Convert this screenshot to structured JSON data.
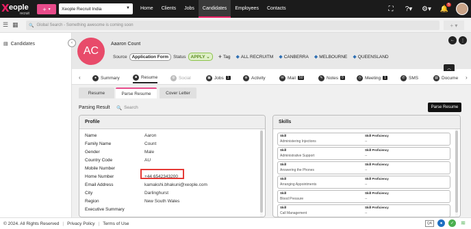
{
  "topbar": {
    "logo_main": "eople",
    "logo_sub": "recruit",
    "tenant": "Xeople Recruit India",
    "nav": [
      {
        "label": "Home"
      },
      {
        "label": "Clients"
      },
      {
        "label": "Jobs"
      },
      {
        "label": "Candidates"
      },
      {
        "label": "Employees"
      },
      {
        "label": "Contacts"
      }
    ],
    "notification_count": "5",
    "accent_color": "#e84b8a"
  },
  "searchbar": {
    "placeholder": "Global Search - Something awesome is coming soon"
  },
  "sidebar": {
    "items": [
      {
        "label": "Candidates"
      }
    ]
  },
  "candidate": {
    "initials": "AC",
    "name": "Aaaron Count",
    "source_label": "Source",
    "source_value": "Application Form",
    "status_label": "Status",
    "status_value": "APPLY",
    "add_tag_label": "Tag",
    "tags": [
      "ALL RECRUITM",
      "CANBERRA",
      "MELBOURNE",
      "QUEENSLAND"
    ]
  },
  "tabs": [
    {
      "label": "Summary",
      "count": ""
    },
    {
      "label": "Resume",
      "count": ""
    },
    {
      "label": "Social",
      "count": ""
    },
    {
      "label": "Jobs",
      "count": "1"
    },
    {
      "label": "Activity",
      "count": ""
    },
    {
      "label": "Mail",
      "count": "50"
    },
    {
      "label": "Notes",
      "count": "0"
    },
    {
      "label": "Meeting",
      "count": "1"
    },
    {
      "label": "SMS",
      "count": ""
    },
    {
      "label": "Docume",
      "count": ""
    }
  ],
  "subtabs": [
    {
      "label": "Resume"
    },
    {
      "label": "Parse Resume"
    },
    {
      "label": "Cover Letter"
    }
  ],
  "parsing": {
    "title": "Parsing Result",
    "search_placeholder": "Search",
    "parse_button": "Parse Resume"
  },
  "profile": {
    "title": "Profile",
    "rows": [
      {
        "label": "Name",
        "value": "Aaron"
      },
      {
        "label": "Family Name",
        "value": "Count"
      },
      {
        "label": "Gender",
        "value": "Male"
      },
      {
        "label": "Country Code",
        "value": "AU"
      },
      {
        "label": "Mobile Number",
        "value": ""
      },
      {
        "label": "Home Number",
        "value": "+44 6542343200"
      },
      {
        "label": "Email Address",
        "value": "kamakshi.bhakuni@xeople.com"
      },
      {
        "label": "City",
        "value": "Darlinghurst"
      },
      {
        "label": "Region",
        "value": "New South Wales"
      },
      {
        "label": "Executive Summary",
        "value": ""
      }
    ]
  },
  "skills": {
    "title": "Skills",
    "skill_label": "Skill",
    "proficiency_label": "Skill Proficiency",
    "items": [
      {
        "name": "Administering Injections",
        "proficiency": "--"
      },
      {
        "name": "Administrative Support",
        "proficiency": "--"
      },
      {
        "name": "Answering the Phones",
        "proficiency": "--"
      },
      {
        "name": "Arranging Appointments",
        "proficiency": "--"
      },
      {
        "name": "Blood Pressure",
        "proficiency": "--"
      },
      {
        "name": "Call Management",
        "proficiency": "--"
      }
    ]
  },
  "footer": {
    "copyright": "© 2024. All Rights Reserved",
    "privacy": "Privacy Policy",
    "terms": "Terms of Use",
    "qa": "QA"
  }
}
